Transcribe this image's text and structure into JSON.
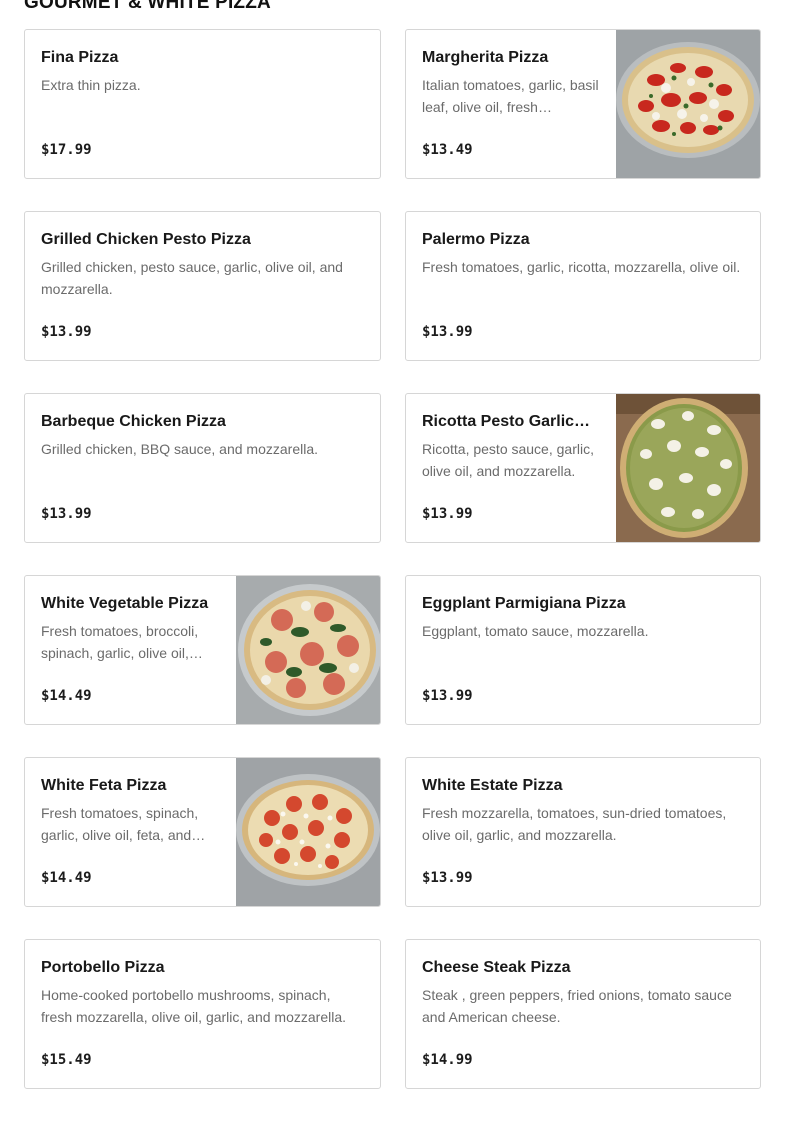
{
  "section": {
    "title": "GOURMET & WHITE PIZZA"
  },
  "items": [
    {
      "name": "Fina Pizza",
      "desc": "Extra thin pizza.",
      "price": "$17.99",
      "image": null
    },
    {
      "name": "Margherita Pizza",
      "desc": "Italian tomatoes, garlic, basil leaf, olive oil, fresh…",
      "price": "$13.49",
      "image": "margherita-pizza-photo"
    },
    {
      "name": "Grilled Chicken Pesto Pizza",
      "desc": "Grilled chicken, pesto sauce, garlic, olive oil, and mozzarella.",
      "price": "$13.99",
      "image": null
    },
    {
      "name": "Palermo Pizza",
      "desc": "Fresh tomatoes, garlic, ricotta, mozzarella, olive oil.",
      "price": "$13.99",
      "image": null
    },
    {
      "name": "Barbeque Chicken Pizza",
      "desc": "Grilled chicken, BBQ sauce, and mozzarella.",
      "price": "$13.99",
      "image": null
    },
    {
      "name": "Ricotta Pesto Garlic…",
      "desc": "Ricotta, pesto sauce, garlic, olive oil, and mozzarella.",
      "price": "$13.99",
      "image": "ricotta-pesto-pizza-photo"
    },
    {
      "name": "White Vegetable Pizza",
      "desc": "Fresh tomatoes, broccoli, spinach, garlic, olive oil,…",
      "price": "$14.49",
      "image": "white-vegetable-pizza-photo"
    },
    {
      "name": "Eggplant Parmigiana Pizza",
      "desc": "Eggplant, tomato sauce, mozzarella.",
      "price": "$13.99",
      "image": null
    },
    {
      "name": "White Feta Pizza",
      "desc": "Fresh tomatoes, spinach, garlic, olive oil, feta, and…",
      "price": "$14.49",
      "image": "white-feta-pizza-photo"
    },
    {
      "name": "White Estate Pizza",
      "desc": "Fresh mozzarella, tomatoes, sun-dried tomatoes, olive oil, garlic, and mozzarella.",
      "price": "$13.99",
      "image": null
    },
    {
      "name": "Portobello Pizza",
      "desc": "Home-cooked portobello mushrooms, spinach, fresh mozzarella, olive oil, garlic, and mozzarella.",
      "price": "$15.49",
      "image": null
    },
    {
      "name": "Cheese Steak Pizza",
      "desc": "Steak , green peppers, fried onions, tomato sauce and American cheese.",
      "price": "$14.99",
      "image": null
    }
  ]
}
